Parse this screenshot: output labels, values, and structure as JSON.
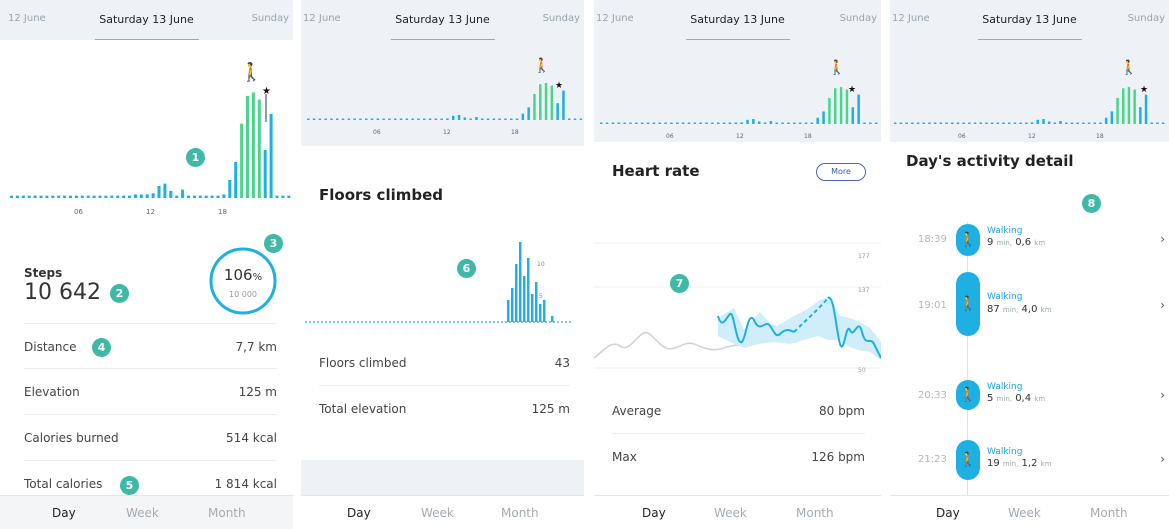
{
  "colors": {
    "accent": "#1fb0e3",
    "green": "#4cd48e",
    "badge": "#40b8a8"
  },
  "header": {
    "prev": "12 June",
    "current": "Saturday 13 June",
    "next": "Sunday"
  },
  "hours": [
    "06",
    "12",
    "18"
  ],
  "steps_chart": {
    "bars_h": [
      2,
      2,
      2,
      2,
      2,
      2,
      2,
      2,
      2,
      2,
      2,
      2,
      2,
      2,
      2,
      2,
      2,
      2,
      2,
      2,
      2,
      3,
      3,
      3,
      4,
      10,
      12,
      6,
      2,
      7,
      2,
      2,
      2,
      2,
      2,
      2,
      3,
      15,
      30,
      62,
      85,
      88,
      82,
      40,
      70,
      2,
      2,
      2
    ]
  },
  "panel1": {
    "badges": [
      "1",
      "2",
      "3",
      "4",
      "5"
    ],
    "steps_label": "Steps",
    "steps_value": "10 642",
    "goal_percent": "106",
    "percent_sign": "%",
    "goal_value": "10 000",
    "goal_fraction": 1.06,
    "rows": [
      {
        "label": "Distance",
        "value": "7,7 km"
      },
      {
        "label": "Elevation",
        "value": "125 m"
      },
      {
        "label": "Calories burned",
        "value": "514 kcal"
      },
      {
        "label": "Total calories",
        "value": "1 814 kcal"
      }
    ]
  },
  "panel2": {
    "title": "Floors climbed",
    "badge": "6",
    "ticks": [
      "10",
      "5"
    ],
    "rows": [
      {
        "label": "Floors climbed",
        "value": "43"
      },
      {
        "label": "Total elevation",
        "value": "125 m"
      }
    ]
  },
  "panel3": {
    "title": "Heart rate",
    "more": "More",
    "badge": "7",
    "ticks": [
      "177",
      "137",
      "50"
    ],
    "rows": [
      {
        "label": "Average",
        "value": "80 bpm"
      },
      {
        "label": "Max",
        "value": "126 bpm"
      }
    ]
  },
  "panel4": {
    "title": "Day's activity detail",
    "badge": "8",
    "activities": [
      {
        "time": "18:39",
        "name": "Walking",
        "dur": "9",
        "dur_unit": "min,",
        "dist": "0,6",
        "dist_unit": "km"
      },
      {
        "time": "19:01",
        "name": "Walking",
        "dur": "87",
        "dur_unit": "min,",
        "dist": "4,0",
        "dist_unit": "km"
      },
      {
        "time": "20:33",
        "name": "Walking",
        "dur": "5",
        "dur_unit": "min,",
        "dist": "0,4",
        "dist_unit": "km"
      },
      {
        "time": "21:23",
        "name": "Walking",
        "dur": "19",
        "dur_unit": "min,",
        "dist": "1,2",
        "dist_unit": "km"
      }
    ]
  },
  "tabs": [
    "Day",
    "Week",
    "Month"
  ],
  "icons": {
    "walker": "walking-icon",
    "star": "star-icon",
    "chevron": "chevron-right-icon"
  }
}
